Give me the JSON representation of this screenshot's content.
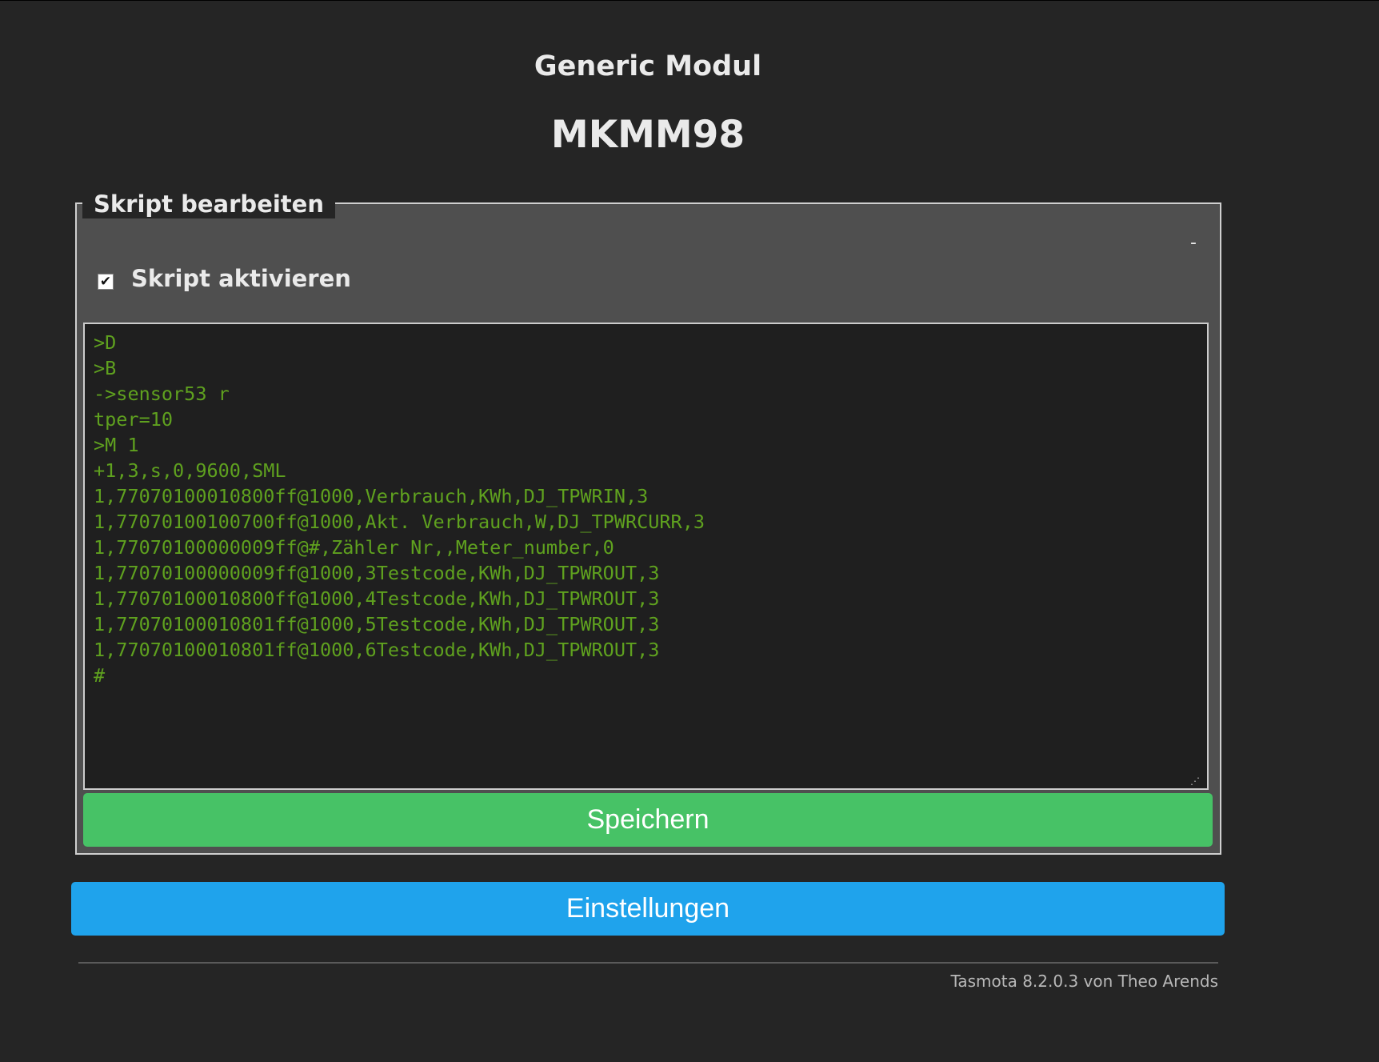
{
  "header": {
    "module_name": "Generic Modul",
    "device_name": "MKMM98"
  },
  "script_editor": {
    "legend": "Skript bearbeiten",
    "minus_marker": "-",
    "enable_checkbox": {
      "checked": true,
      "check_glyph": "✔",
      "label": "Skript aktivieren"
    },
    "lines": [
      ">D",
      ">B",
      "->sensor53 r",
      "tper=10",
      ">M 1",
      "+1,3,s,0,9600,SML",
      "1,77070100010800ff@1000,Verbrauch,KWh,DJ_TPWRIN,3",
      "1,77070100100700ff@1000,Akt. Verbrauch,W,DJ_TPWRCURR,3",
      "1,77070100000009ff@#,Zähler Nr,,Meter_number,0",
      "1,77070100000009ff@1000,3Testcode,KWh,DJ_TPWROUT,3",
      "1,77070100010800ff@1000,4Testcode,KWh,DJ_TPWROUT,3",
      "1,77070100010801ff@1000,5Testcode,KWh,DJ_TPWROUT,3",
      "1,77070100010801ff@1000,6Testcode,KWh,DJ_TPWROUT,3",
      "#"
    ],
    "text_color": "#5fa11f",
    "save_label": "Speichern",
    "save_color": "#47c266"
  },
  "buttons": {
    "settings_label": "Einstellungen",
    "settings_color": "#1fa3ec"
  },
  "footer": {
    "text": "Tasmota 8.2.0.3 von Theo Arends"
  }
}
